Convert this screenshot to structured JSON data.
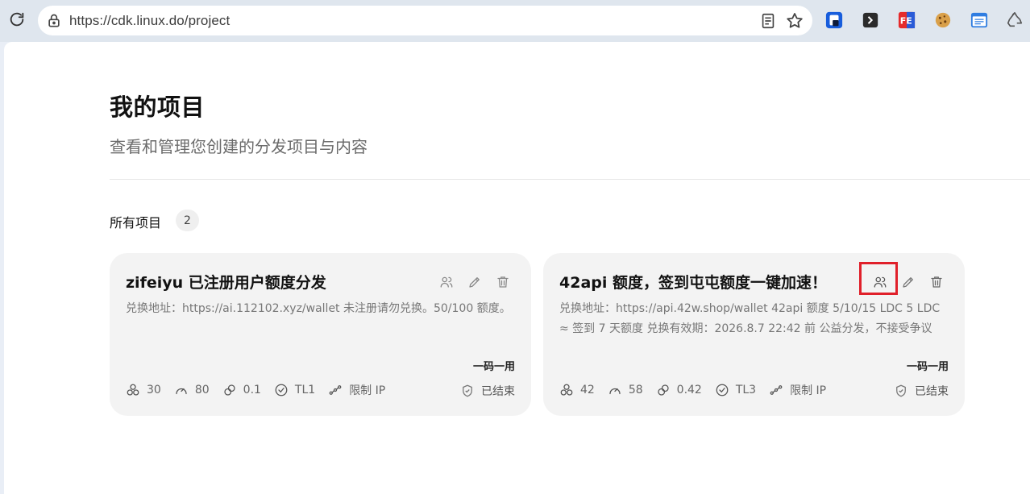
{
  "browser": {
    "url": "https://cdk.linux.do/project",
    "extensions": [
      "password-manager-icon",
      "terminal-icon",
      "fe-helper-icon",
      "cookie-icon",
      "browser-window-icon",
      "recycle-icon"
    ]
  },
  "page": {
    "title": "我的项目",
    "subtitle": "查看和管理您创建的分发项目与内容"
  },
  "section": {
    "label": "所有项目",
    "count": "2"
  },
  "projects": [
    {
      "title": "zifeiyu 已注册用户额度分发",
      "description": "兑换地址：https://ai.112102.xyz/wallet 未注册请勿兑换。50/100 额度。",
      "mode": "一码一用",
      "stats": {
        "total": "30",
        "speed": "80",
        "risk": "0.1",
        "trust_level": "TL1",
        "ip": "限制 IP"
      },
      "status": "已结束"
    },
    {
      "title": "42api 额度，签到屯屯额度一键加速！",
      "description": "兑换地址：https://api.42w.shop/wallet 42api 额度 5/10/15 LDC 5 LDC ≈ 签到 7 天额度 兑换有效期：2026.8.7 22:42 前 公益分发，不接受争议",
      "mode": "一码一用",
      "stats": {
        "total": "42",
        "speed": "58",
        "risk": "0.42",
        "trust_level": "TL3",
        "ip": "限制 IP"
      },
      "status": "已结束"
    }
  ],
  "colors": {
    "highlight": "#e0202a",
    "card_bg": "#f3f3f3"
  }
}
